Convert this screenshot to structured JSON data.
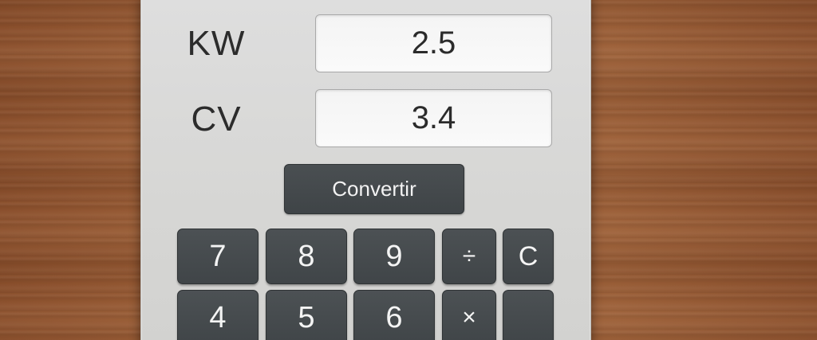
{
  "converter": {
    "kw_label": "KW",
    "kw_value": "2.5",
    "cv_label": "CV",
    "cv_value": "3.4",
    "convert_label": "Convertir"
  },
  "keypad": {
    "row1": [
      "7",
      "8",
      "9",
      "÷",
      "C"
    ],
    "row2": [
      "4",
      "5",
      "6",
      "×",
      ""
    ]
  },
  "colors": {
    "panel": "#d8d8d6",
    "key": "#454a4d",
    "key_text": "#f4f4f4",
    "field": "#f7f7f7",
    "wood": "#8f5430"
  }
}
